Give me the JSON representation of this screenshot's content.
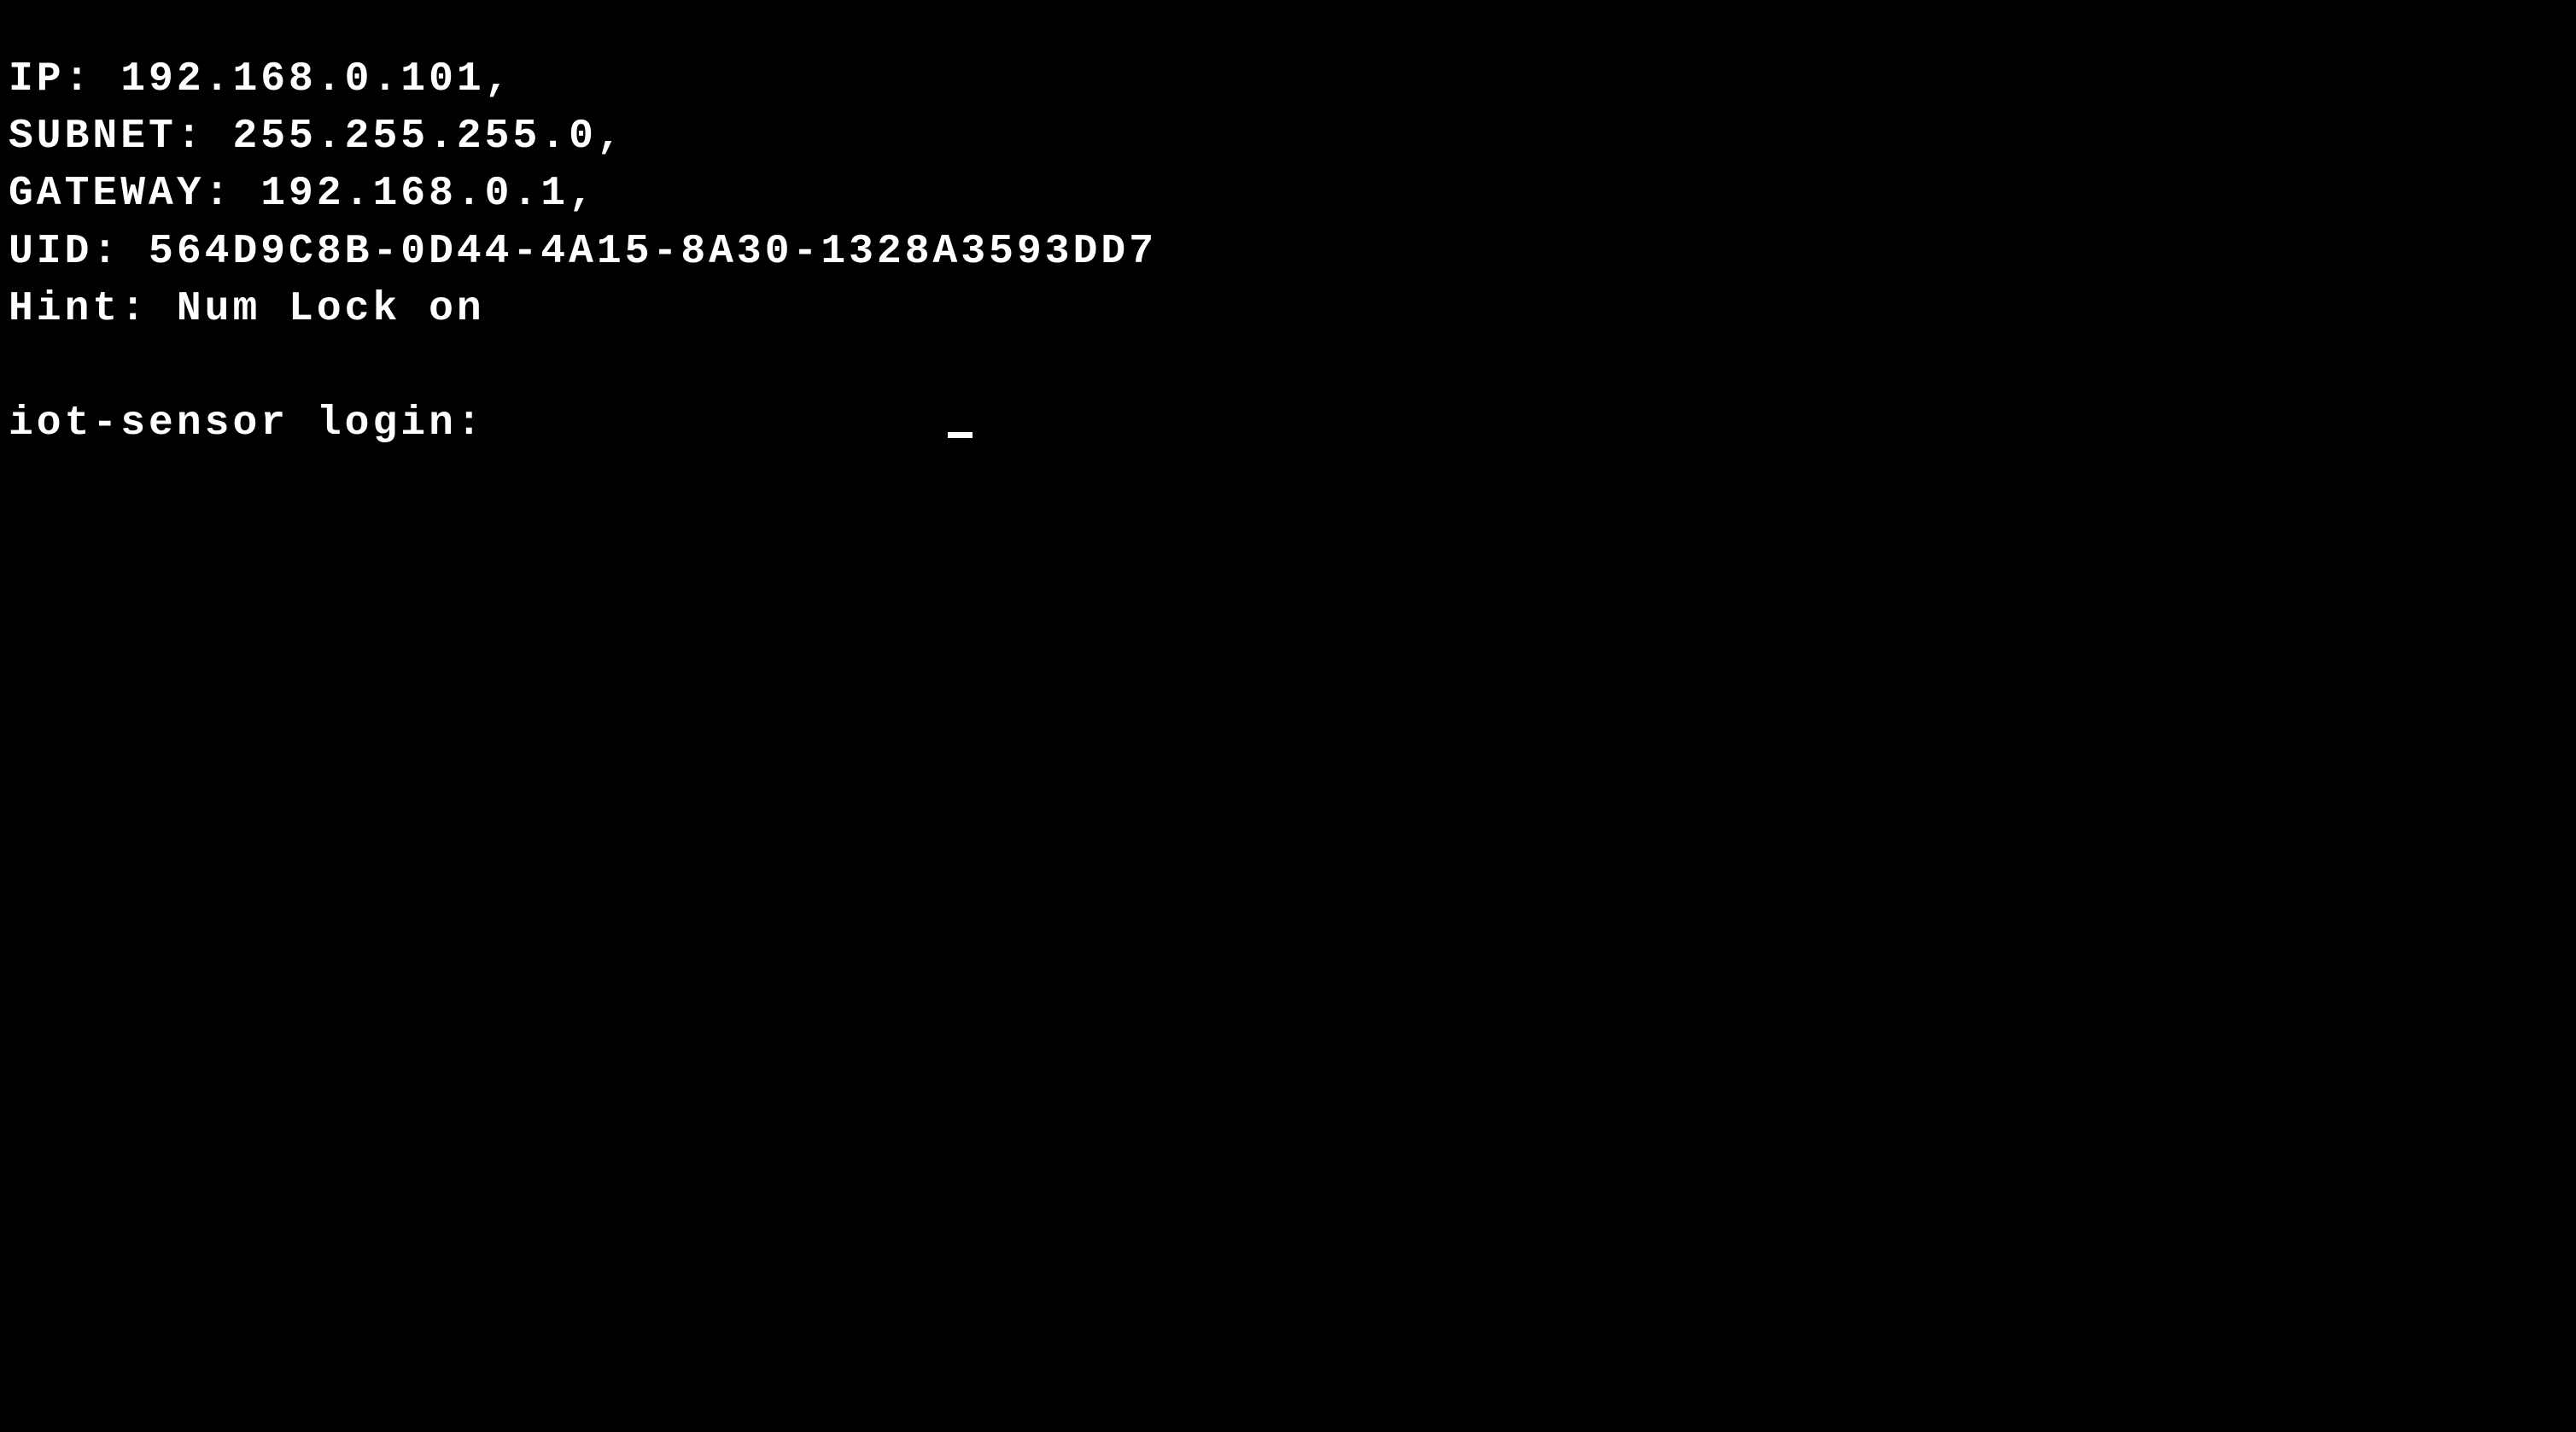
{
  "terminal": {
    "lines": {
      "ip": "IP: 192.168.0.101,",
      "subnet": "SUBNET: 255.255.255.0,",
      "gateway": "GATEWAY: 192.168.0.1,",
      "uid": "UID: 564D9C8B-0D44-4A15-8A30-1328A3593DD7",
      "hint": "Hint: Num Lock on"
    },
    "login_prompt": "iot-sensor login: ",
    "login_value": ""
  }
}
